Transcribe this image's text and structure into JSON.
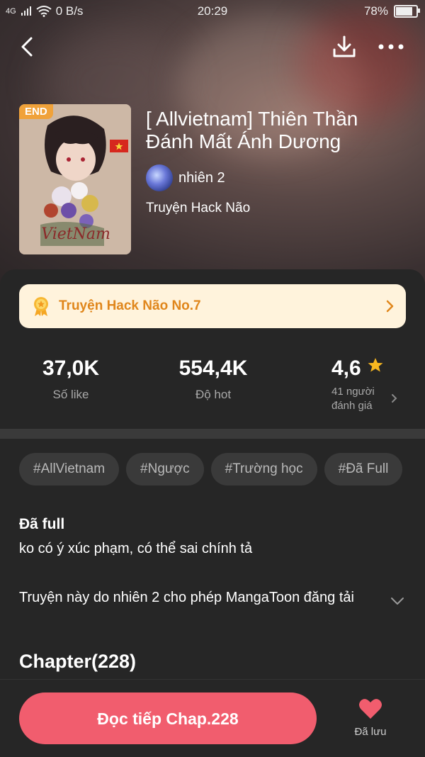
{
  "status_bar": {
    "signal": "4G",
    "net_speed": "0 B/s",
    "time": "20:29",
    "battery": "78%",
    "battery_level": 0.78
  },
  "topbar": {
    "back_icon": "back-chevron-icon",
    "download_icon": "download-icon",
    "more_icon": "more-dots-icon"
  },
  "comic": {
    "badge": "END",
    "title": "[ Allvietnam] Thiên Thần Đánh Mất Ánh Dương",
    "author": "nhiên 2",
    "genre": "Truyện Hack Não"
  },
  "rank": {
    "label": "Truyện Hack Não No.7",
    "medal_icon": "medal-icon",
    "color": "#e0861b"
  },
  "stats": {
    "likes": {
      "value": "37,0K",
      "label": "Số like"
    },
    "hot": {
      "value": "554,4K",
      "label": "Độ hot"
    },
    "rating": {
      "value": "4,6",
      "label_line1": "41 người",
      "label_line2": "đánh giá"
    }
  },
  "tags": [
    "#AllVietnam",
    "#Ngược",
    "#Trường học",
    "#Đã Full"
  ],
  "description": {
    "title": "Đã full",
    "text": "ko có ý xúc phạm, có thể sai chính tả",
    "permission": "Truyện này do nhiên 2 cho phép MangaToon đăng tải"
  },
  "chapters": {
    "title": "Chapter(228)"
  },
  "bottom": {
    "read_button": "Đọc tiếp Chap.228",
    "saved_label": "Đã lưu",
    "accent": "#f15d6e"
  }
}
